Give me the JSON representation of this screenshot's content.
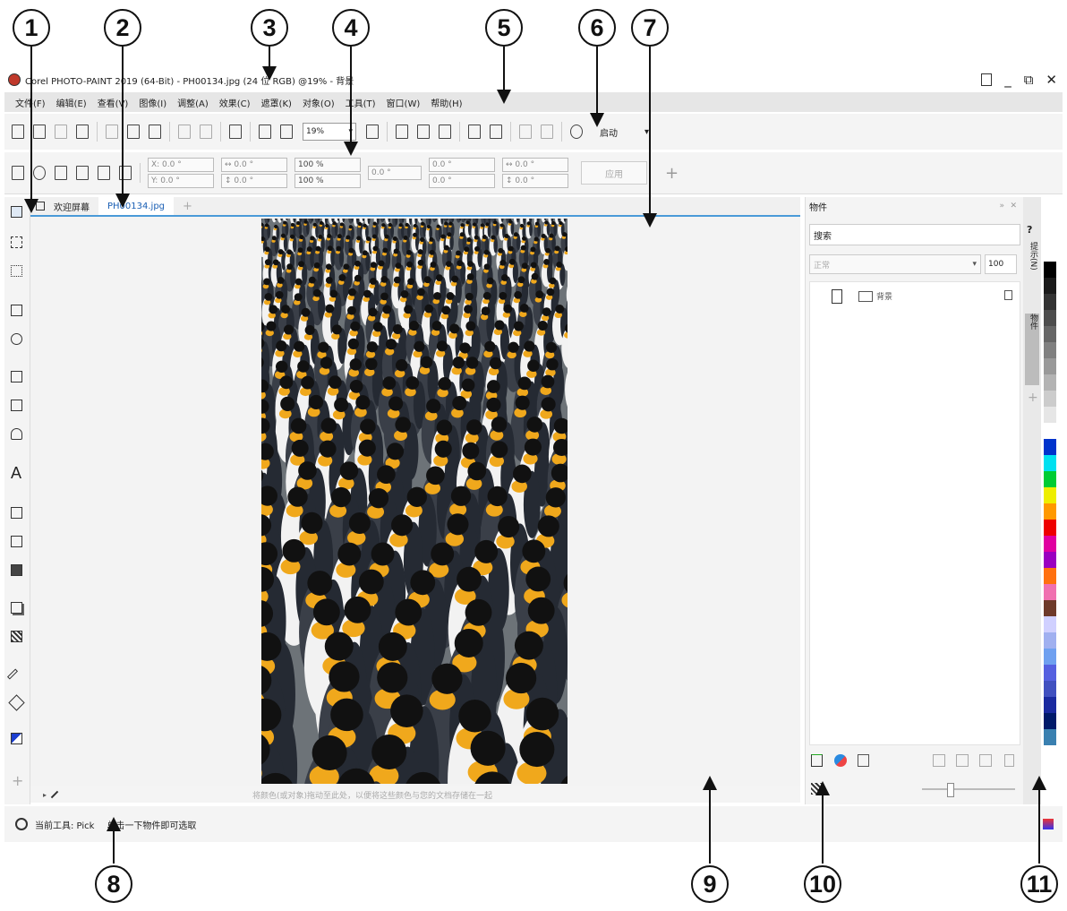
{
  "callouts": [
    "1",
    "2",
    "3",
    "4",
    "5",
    "6",
    "7",
    "8",
    "9",
    "10",
    "11"
  ],
  "window": {
    "title": "Corel PHOTO-PAINT 2019 (64-Bit) - PH00134.jpg (24 位 RGB) @19% - 背景",
    "controls": [
      "_",
      "⧉",
      "✕"
    ]
  },
  "menu": [
    "文件(F)",
    "编辑(E)",
    "查看(V)",
    "图像(I)",
    "调整(A)",
    "效果(C)",
    "遮罩(K)",
    "对象(O)",
    "工具(T)",
    "窗口(W)",
    "帮助(H)"
  ],
  "toolbar": {
    "zoom_value": "19%",
    "zoom_arrow": "▾",
    "launch_label": "启动",
    "launch_arrow": "▾"
  },
  "propbar": {
    "field_groups": [
      [
        "X: 0.0 °",
        "Y: 0.0 °"
      ],
      [
        "↔ 0.0 °",
        "↕ 0.0 °"
      ],
      [
        "100 %",
        "100 %"
      ],
      [
        "0.0 °"
      ],
      [
        "0.0 °",
        "0.0 °"
      ],
      [
        "↔ 0.0 °",
        "↕ 0.0 °"
      ]
    ],
    "apply_label": "应用",
    "add_label": "+"
  },
  "tabs": {
    "welcome": "欢迎屏幕",
    "document": "PH00134.jpg",
    "new_tab": "+"
  },
  "status": {
    "hint": "将颜色(或对象)拖动至此处，以便将这些颜色与您的文档存储在一起",
    "current_tool": "当前工具: Pick",
    "message": "单击一下物件即可选取"
  },
  "docker": {
    "title": "物件",
    "search_placeholder": "搜索",
    "blend_mode": "正常",
    "opacity": "100",
    "layer_name": "背景",
    "sidetab_hints": "提示(N)",
    "sidetab_objects": "物件"
  },
  "palette_colors": [
    "#000000",
    "#1a1a1a",
    "#333333",
    "#4d4d4d",
    "#666666",
    "#808080",
    "#999999",
    "#b3b3b3",
    "#cccccc",
    "#e6e6e6",
    "#ffffff",
    "#0033cc",
    "#00e0f0",
    "#00cc33",
    "#eeee00",
    "#ff9900",
    "#ee0000",
    "#e000a0",
    "#9a00c0",
    "#ff7010",
    "#f070b0",
    "#6e3a2a",
    "#d0d0ff",
    "#a0b0f0",
    "#6fa0f0",
    "#5560e0",
    "#4050c0",
    "#1a2aa0",
    "#001a6a",
    "#3a80b0"
  ]
}
